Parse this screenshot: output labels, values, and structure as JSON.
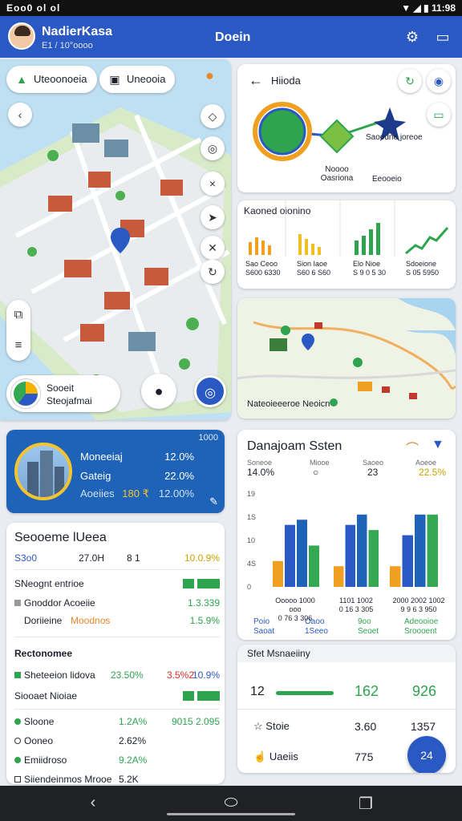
{
  "status_bar": {
    "left": "Eoo0 ol ol",
    "right": "▼ ◢ ▮ 11:98"
  },
  "app_bar": {
    "user_name": "NadierKasa",
    "user_sub": "E1 / 10°oooo",
    "title": "Doein"
  },
  "map": {
    "chips": [
      {
        "label": "Uteoonoeia",
        "icon": "car-icon"
      },
      {
        "label": "Uneooia",
        "icon": "image-icon"
      }
    ],
    "location": {
      "line1": "Sooeit",
      "line2": "Steojafmai"
    }
  },
  "kpi_card": {
    "year": "1000",
    "rows": [
      {
        "label": "Moneeiaj",
        "value": "12.0%"
      },
      {
        "label": "Gateig",
        "value": "22.0%"
      },
      {
        "label": "Aoeiies",
        "inline": "180 ₹",
        "value": "12.00%"
      }
    ]
  },
  "table_card": {
    "title": "Seooeme lUeea",
    "header": [
      "S3o0",
      "27.0H",
      "8 1",
      "10.0.9%"
    ],
    "rows": [
      {
        "label": "SNeognt entrioe",
        "value": "",
        "bar": true
      },
      {
        "label": "Gnoddor Acoeiie",
        "value": "1.3.339"
      },
      {
        "label": "Doriieine",
        "extra": "Moodnos",
        "value": "1.5.9%"
      }
    ],
    "section2": "Rectonomee",
    "rows2": [
      {
        "label": "Sheteeion lidova",
        "v1": "23.50%",
        "v2": "3.5%2",
        "v3": "10.9%"
      },
      {
        "label": "Siooaet Nioiae",
        "value": "",
        "bar": true
      }
    ],
    "rows3": [
      {
        "label": "Sloone",
        "v1": "1.2A%",
        "value": "9015 2.095"
      },
      {
        "label": "Ooneo",
        "v1": "2.62%",
        "value": ""
      },
      {
        "label": "Emiidroso",
        "v1": "9.2A%",
        "value": ""
      },
      {
        "label": "Siiendeinmos Mrooe",
        "v1": "5.2K",
        "value": ""
      }
    ]
  },
  "route_card": {
    "title": "Hiioda",
    "node1_a": "Noooo",
    "node1_b": "Oasriona",
    "node2": "Saoodne joreoe",
    "node3": "Eeooeio"
  },
  "mini_chart_card": {
    "title": "Kaoned oionino",
    "labels": [
      {
        "a": "Sao Ceoo",
        "b": "S600 6330"
      },
      {
        "a": "Sion Iaoe",
        "b": "S60 6 S60"
      },
      {
        "a": "Elo Nioe",
        "b": "S 9 0 5 30"
      },
      {
        "a": "Sdoeione",
        "b": "S 05 5950"
      }
    ]
  },
  "map2": {
    "label": "Nateoieeeroe Neoicn"
  },
  "dashboard": {
    "title": "Danajoam Ssten",
    "stats": [
      {
        "label": "Soneoe",
        "value": "14.0%"
      },
      {
        "label": "Miooe",
        "value": "○"
      },
      {
        "label": "Saoeo",
        "value": "23"
      },
      {
        "label": "Aoeoe",
        "value": "22.5%"
      }
    ],
    "footer_labels": [
      {
        "a": "Poio",
        "b": "Saoat"
      },
      {
        "a": "Oaoo",
        "b": "1Seeo"
      },
      {
        "a": "9oo",
        "b": "Seoet"
      },
      {
        "a": "Adeooioe",
        "b": "Sroooent"
      }
    ],
    "x_labels": [
      "Ooooo 1000 ooo",
      "1101 1002",
      "2000 2002 1002"
    ],
    "x_sub": [
      "0 76 3 306",
      "0 16 3 305",
      "9 9 6 3 950"
    ]
  },
  "chart_data": {
    "type": "bar",
    "categories": [
      "Ooooo 1000 ooo",
      "1101 1002",
      "2000 2002 1002"
    ],
    "ylim": [
      0,
      18
    ],
    "y_ticks": [
      "0",
      "4S",
      "10",
      "1S",
      "19"
    ],
    "series": [
      {
        "values": [
          5,
          4,
          4
        ],
        "color": "#f0a020"
      },
      {
        "values": [
          12,
          12,
          10
        ],
        "color": "#2b59c3"
      },
      {
        "values": [
          13,
          14,
          14
        ],
        "color": "#1e63b8"
      },
      {
        "values": [
          8,
          11,
          14
        ],
        "color": "#34a853"
      }
    ]
  },
  "metrics": {
    "title": "Sfet Msnaeiiny",
    "rows": [
      {
        "label": "12",
        "v1": "162",
        "v2": "926"
      },
      {
        "label": "Stoie",
        "v1": "3.60",
        "v2": "1357"
      },
      {
        "label": "Uaeiis",
        "v1": "775",
        "v2": ""
      }
    ],
    "fab": "24"
  }
}
